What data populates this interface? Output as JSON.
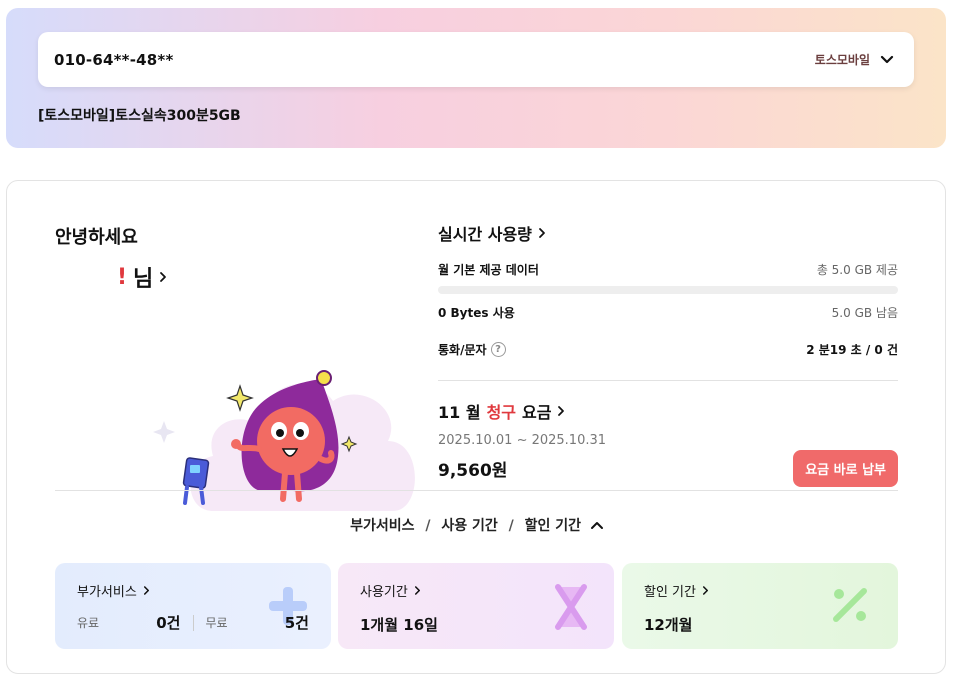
{
  "header": {
    "phone_number": "010-64**-48**",
    "carrier": "토스모바일",
    "plan_name": "[토스모바일]토스실속300분5GB"
  },
  "profile": {
    "greeting": "안녕하세요",
    "name_mark": "!",
    "name_suffix": "님"
  },
  "usage": {
    "title": "실시간 사용량",
    "data_label": "월 기본 제공 데이터",
    "data_total": "총 5.0 GB 제공",
    "data_used": "0 Bytes 사용",
    "data_remaining": "5.0 GB 남음",
    "data_used_fraction": 0,
    "call_label": "통화/문자",
    "call_value": "2 분19 초 / 0 건"
  },
  "bill": {
    "month": "11 월",
    "highlight": "청구",
    "suffix": "요금",
    "period": "2025.10.01 ~ 2025.10.31",
    "amount": "9,560원",
    "pay_button": "요금 바로 납부"
  },
  "toggle": {
    "item1": "부가서비스",
    "item2": "사용 기간",
    "item3": "할인 기간",
    "separator": "/"
  },
  "cards": {
    "addon": {
      "title": "부가서비스",
      "paid_label": "유료",
      "paid_value": "0건",
      "free_label": "무료",
      "free_value": "5건"
    },
    "usage_period": {
      "title": "사용기간",
      "value": "1개월 16일"
    },
    "discount_period": {
      "title": "할인 기간",
      "value": "12개월"
    }
  },
  "colors": {
    "accent_red": "#e0393e",
    "pay_button": "#f06a6a"
  }
}
